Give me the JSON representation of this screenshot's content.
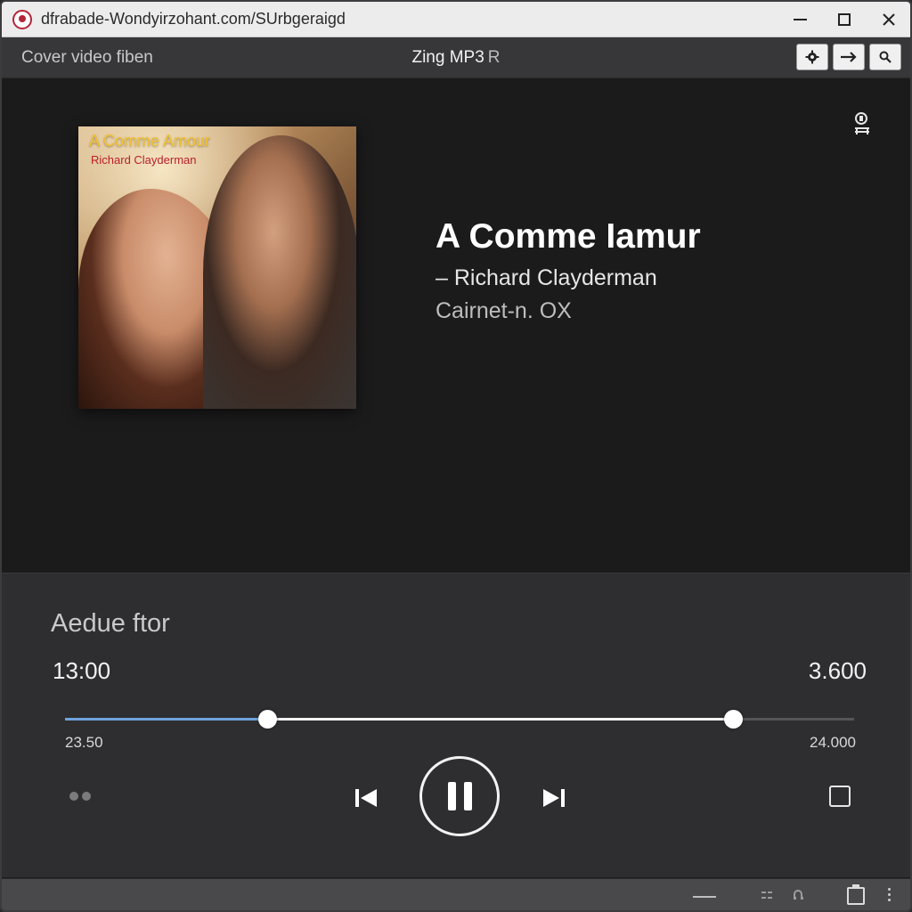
{
  "titlebar": {
    "url": "dfrabade-Wondyirzohant.com/SUrbgeraigd",
    "minimize_label": "minimize",
    "maximize_label": "maximize",
    "close_label": "close"
  },
  "header": {
    "left_label": "Cover video fiben",
    "app_name": "Zing MP3",
    "app_suffix": "R",
    "tools": [
      "gear-icon",
      "arrow-right-icon",
      "search-icon"
    ]
  },
  "cover": {
    "title": "A Comme Amour",
    "artist": "Richard Clayderman"
  },
  "track": {
    "title": "A Comme Iamur",
    "artist": "– Richard Clayderman",
    "extra": "Cairnet-n. OX"
  },
  "player": {
    "label": "Aedue ftor",
    "time_left": "13:00",
    "time_right": "3.600",
    "scale_left": "23.50",
    "scale_right": "24.000",
    "progress_fraction": 0.256,
    "range_end_fraction": 0.846
  },
  "colors": {
    "accent_blue": "#6fa3dc",
    "cover_title": "#f3c230",
    "cover_artist": "#b8202a"
  }
}
